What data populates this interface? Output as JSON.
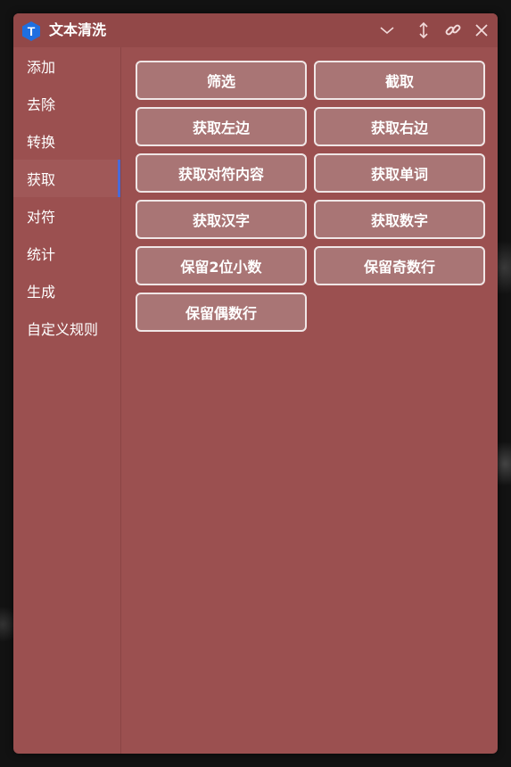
{
  "window": {
    "title": "文本清洗",
    "app_icon_letter": "T",
    "accent_color": "#9b5050",
    "title_icons": [
      "chevron-down-icon",
      "resize-vertical-icon",
      "link-icon",
      "close-icon"
    ]
  },
  "sidebar": {
    "items": [
      {
        "label": "添加",
        "active": false
      },
      {
        "label": "去除",
        "active": false
      },
      {
        "label": "转换",
        "active": false
      },
      {
        "label": "获取",
        "active": true
      },
      {
        "label": "对符",
        "active": false
      },
      {
        "label": "统计",
        "active": false
      },
      {
        "label": "生成",
        "active": false
      },
      {
        "label": "自定义规则",
        "active": false
      }
    ]
  },
  "actions": {
    "buttons": [
      {
        "label": "筛选"
      },
      {
        "label": "截取"
      },
      {
        "label": "获取左边"
      },
      {
        "label": "获取右边"
      },
      {
        "label": "获取对符内容"
      },
      {
        "label": "获取单词"
      },
      {
        "label": "获取汉字"
      },
      {
        "label": "获取数字"
      },
      {
        "label": "保留2位小数"
      },
      {
        "label": "保留奇数行"
      },
      {
        "label": "保留偶数行"
      }
    ]
  }
}
